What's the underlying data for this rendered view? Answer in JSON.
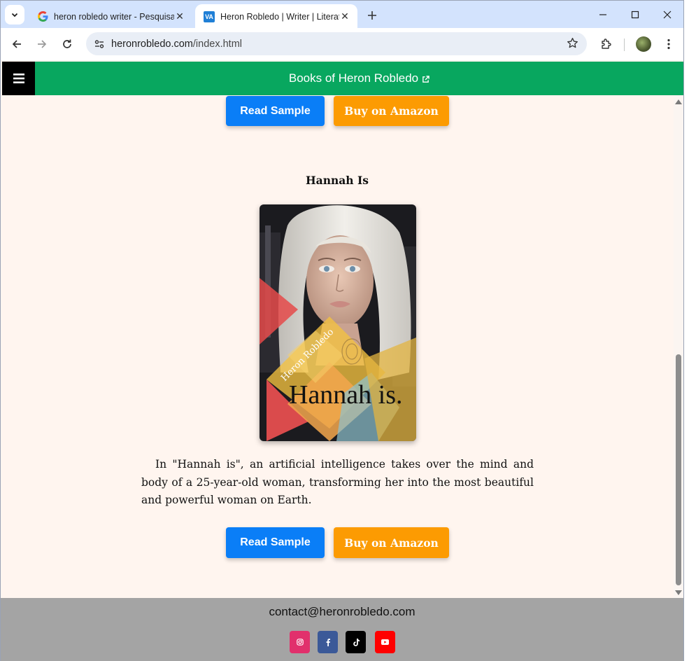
{
  "browser": {
    "tabs": [
      {
        "title": "heron robledo writer - Pesquisa",
        "favicon": "google-g-icon",
        "active": false
      },
      {
        "title": "Heron Robledo | Writer | Literat",
        "favicon": "va-icon",
        "favicon_text": "VA",
        "active": true
      }
    ],
    "url_host": "heronrobledo.com",
    "url_path": "/index.html"
  },
  "header": {
    "title": "Books of Heron Robledo",
    "color": "#08a75f"
  },
  "top_buttons": {
    "read_sample": "Read Sample",
    "buy_amazon": "Buy on Amazon"
  },
  "book": {
    "title": "Hannah Is",
    "cover_author": "Heron Robledo",
    "cover_title": "Hannah is.",
    "description": "In \"Hannah is\", an artificial intelligence takes over the mind and body of a 25-year-old woman, transforming her into the most beautiful and powerful woman on Earth.",
    "read_sample": "Read Sample",
    "buy_amazon": "Buy on Amazon"
  },
  "footer": {
    "contact": "contact@heronrobledo.com",
    "social": [
      {
        "name": "instagram-icon",
        "color": "#e1306c"
      },
      {
        "name": "facebook-icon",
        "color": "#3b5998"
      },
      {
        "name": "tiktok-icon",
        "color": "#000000"
      },
      {
        "name": "youtube-icon",
        "color": "#ff0000"
      }
    ]
  },
  "colors": {
    "page_bg": "#fff5ef",
    "read_sample": "#0a7ef7",
    "amazon": "#fc9b02",
    "footer": "#a4a4a4"
  }
}
